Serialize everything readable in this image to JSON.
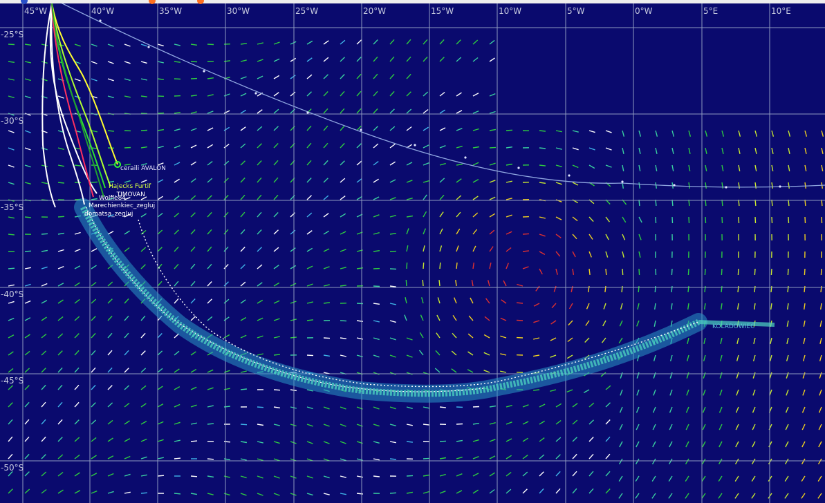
{
  "map": {
    "sea_color": "#0a0a6e",
    "grid_color": "#8f9bc0",
    "lon_labels": [
      "45°W",
      "40°W",
      "35°W",
      "30°W",
      "25°W",
      "20°W",
      "15°W",
      "10°W",
      "5°W",
      "0°W",
      "5°E",
      "10°E"
    ],
    "lat_labels": [
      "-25°S",
      "-30°S",
      "-35°S",
      "-40°S",
      "-45°S",
      "-50°S"
    ],
    "boat_labels": [
      {
        "text": "ceraili AVALON",
        "color": "#e8e8ff"
      },
      {
        "text": "Hajecks Furtif",
        "color": "#d8ff40"
      },
      {
        "text": "...TIMOVAN",
        "color": "#ffffff"
      },
      {
        "text": "Wolfie84",
        "color": "#ffffff"
      },
      {
        "text": "Marechienkiec_zegluj",
        "color": "#ffffff"
      },
      {
        "text": "domatsa_zegluj",
        "color": "#ffffff"
      },
      {
        "text": "KOLADOWIEC",
        "color": "#5cc4d8"
      }
    ],
    "wind_legend_colors": [
      "#3fb4e8",
      "#3ad0a0",
      "#2ecc40",
      "#c8e830",
      "#f0d020",
      "#e03030",
      "#ffffff"
    ]
  }
}
